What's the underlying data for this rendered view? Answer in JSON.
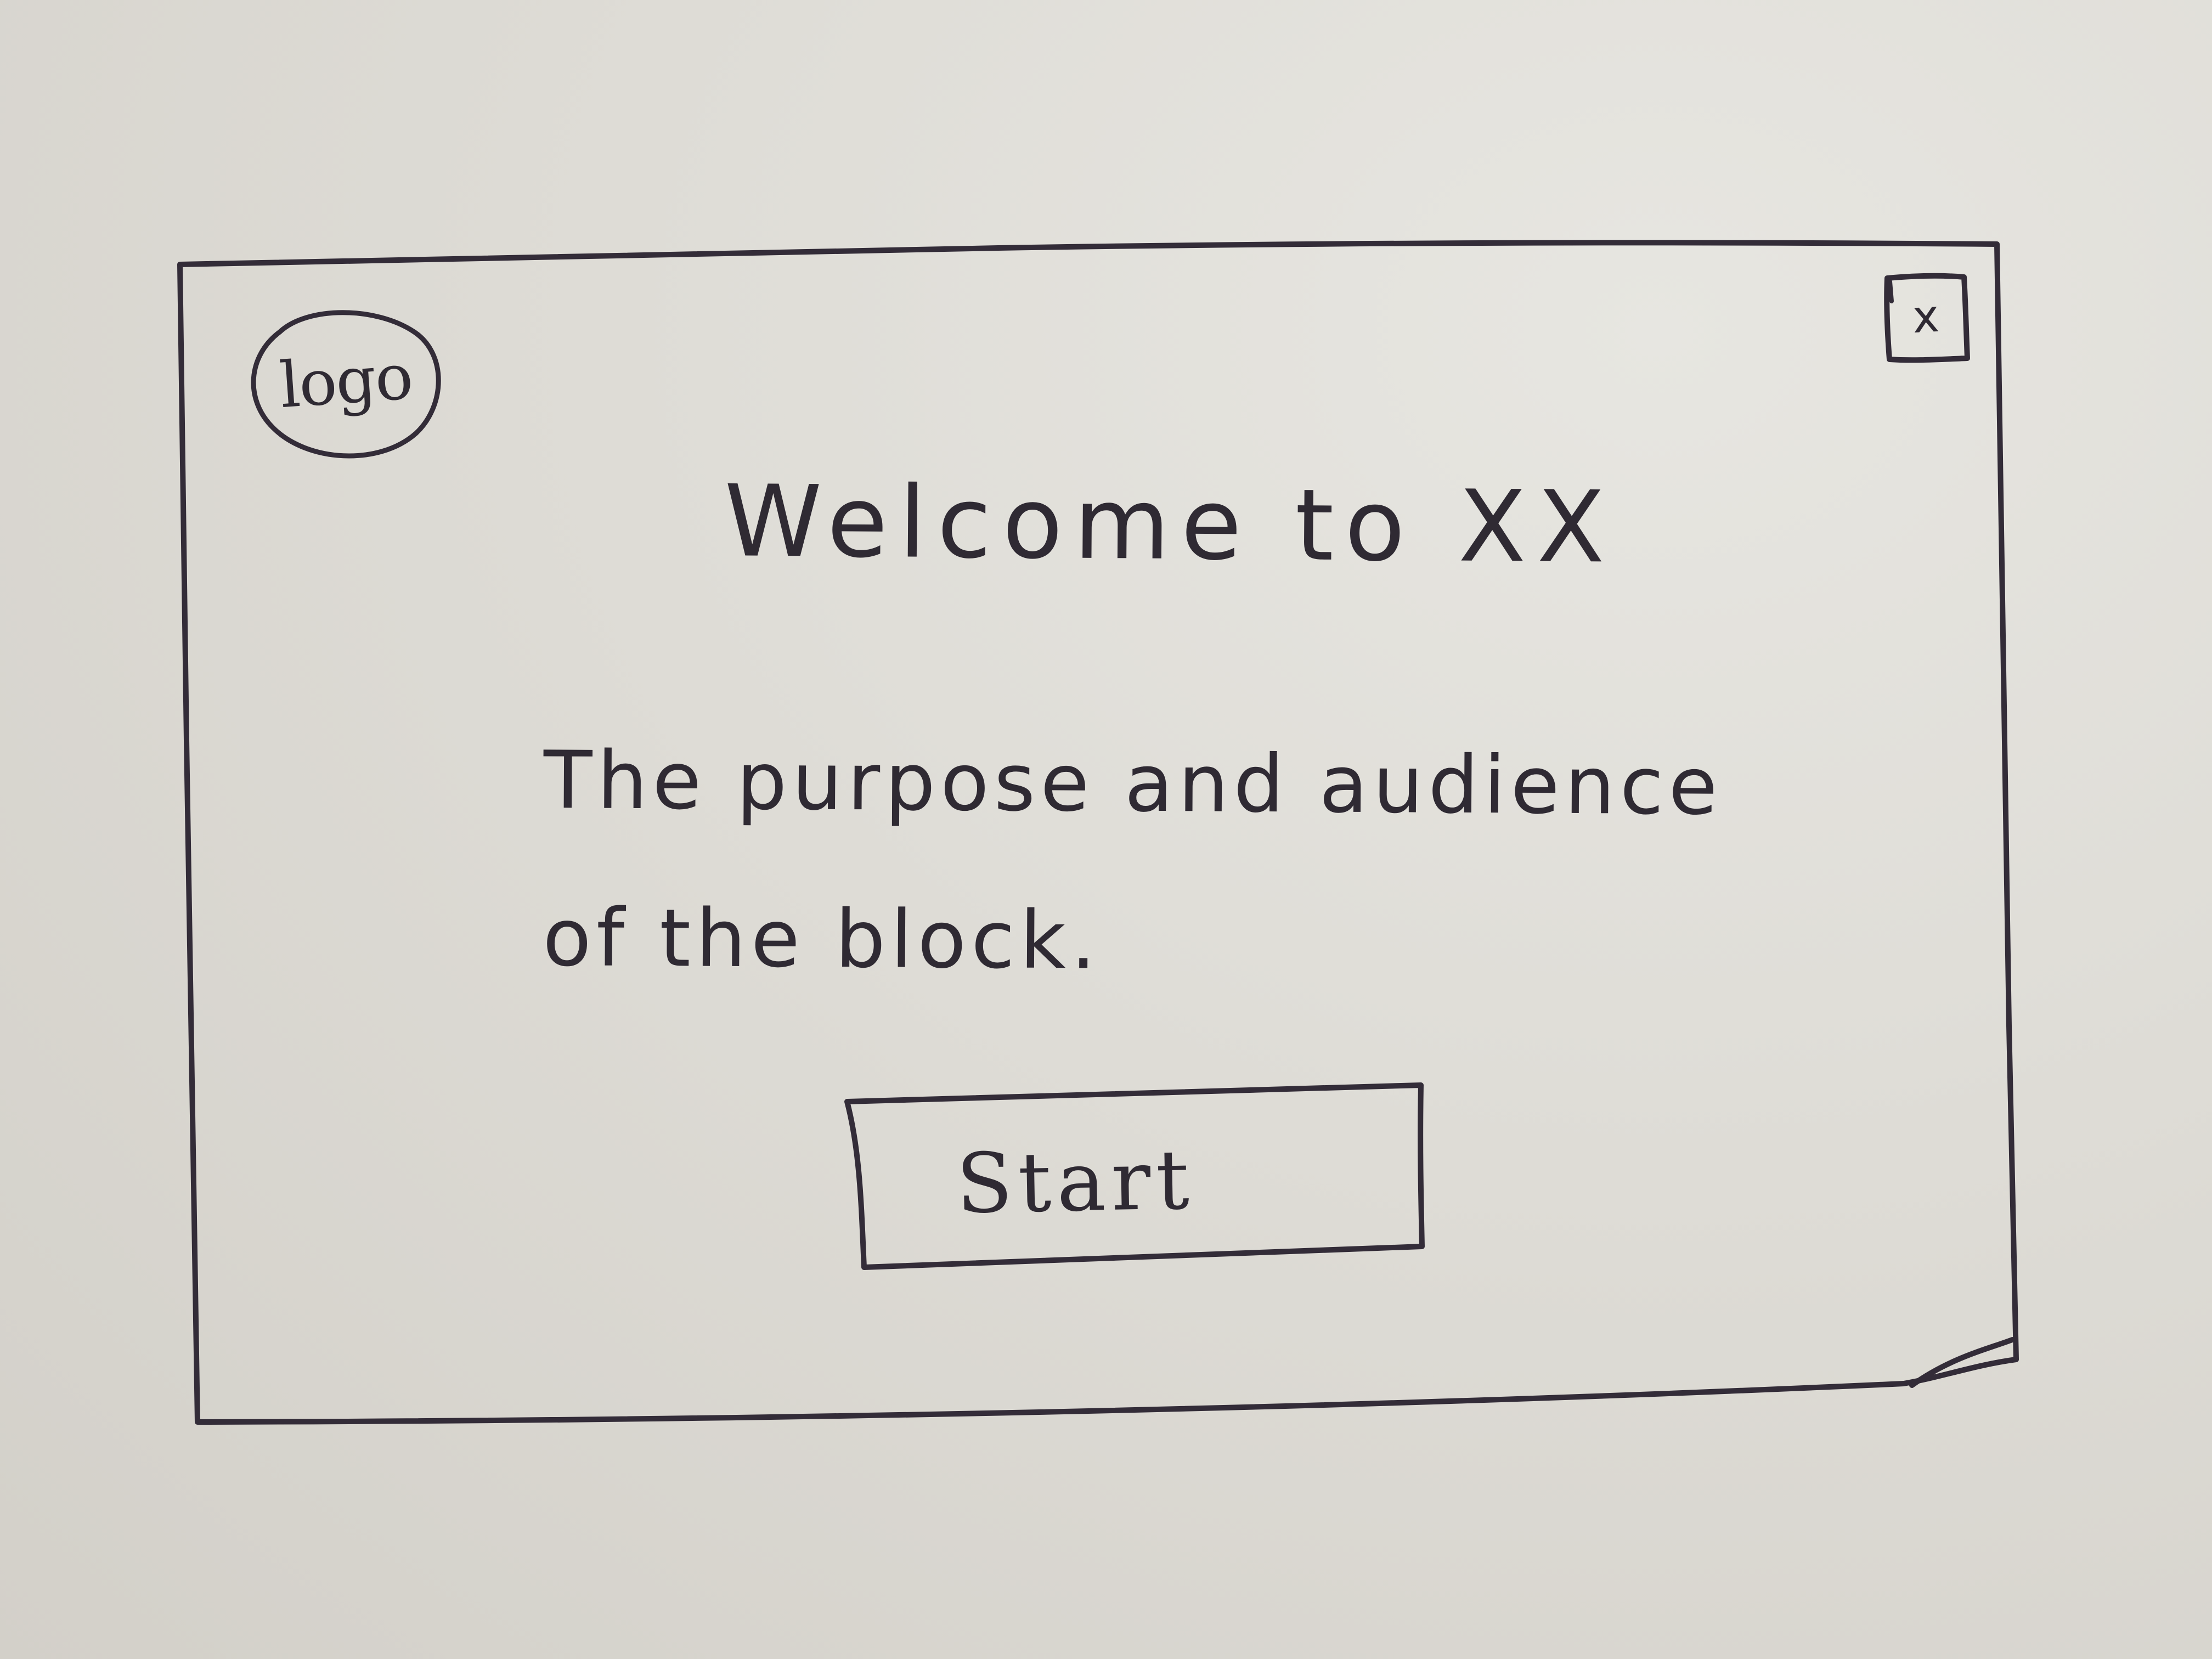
{
  "dialog": {
    "logo_label": "logo",
    "close_label": "x",
    "title": "Welcome to XX",
    "description": "The purpose and audience\nof the block.",
    "start_label": "Start"
  },
  "icons": {
    "logo": "logo-circle-icon",
    "close": "close-icon"
  },
  "colors": {
    "paper": "#dcdad3",
    "ink": "#332c38"
  }
}
